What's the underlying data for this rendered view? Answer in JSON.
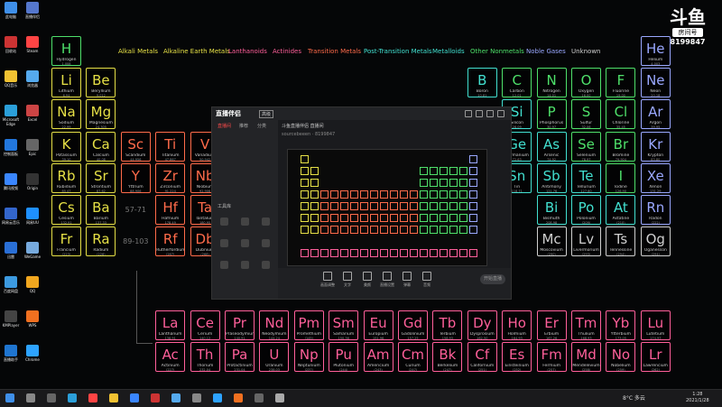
{
  "brand": {
    "logo_mark": "斗鱼",
    "logo_tag": "房间号",
    "room_number": "8199847"
  },
  "legend": [
    {
      "label": "Alkali Metals",
      "color": "#e6e046"
    },
    {
      "label": "Alkaline Earth Metals",
      "color": "#e6e046"
    },
    {
      "label": "Lanthanoids",
      "color": "#ff5f9a"
    },
    {
      "label": "Actinides",
      "color": "#ff5f9a"
    },
    {
      "label": "Transition Metals",
      "color": "#ff6b4a"
    },
    {
      "label": "Post-Transition Metals",
      "color": "#42e0d0"
    },
    {
      "label": "Metalloids",
      "color": "#42e0d0"
    },
    {
      "label": "Other Nonmetals",
      "color": "#4ee06a"
    },
    {
      "label": "Noble Gases",
      "color": "#9aa8ff"
    },
    {
      "label": "Unknown",
      "color": "#cfcfcf"
    }
  ],
  "colors": {
    "alkali": "#e6e046",
    "alkaline": "#e6e046",
    "transition": "#ff6b4a",
    "post": "#42e0d0",
    "metalloid": "#42e0d0",
    "nonmetal": "#4ee06a",
    "noble": "#9aa8ff",
    "lanthanoid": "#ff5f9a",
    "actinide": "#ff5f9a",
    "unknown": "#cfcfcf"
  },
  "elements": [
    {
      "sym": "H",
      "name": "Hydrogen",
      "wt": "1.008",
      "cat": "nonmetal",
      "col": 1,
      "row": 1
    },
    {
      "sym": "He",
      "name": "Helium",
      "wt": "4.003",
      "cat": "noble",
      "col": 18,
      "row": 1
    },
    {
      "sym": "Li",
      "name": "Lithium",
      "wt": "6.94",
      "cat": "alkali",
      "col": 1,
      "row": 2
    },
    {
      "sym": "Be",
      "name": "Beryllium",
      "wt": "9.012",
      "cat": "alkaline",
      "col": 2,
      "row": 2
    },
    {
      "sym": "B",
      "name": "Boron",
      "wt": "10.81",
      "cat": "metalloid",
      "col": 13,
      "row": 2
    },
    {
      "sym": "C",
      "name": "Carbon",
      "wt": "12.01",
      "cat": "nonmetal",
      "col": 14,
      "row": 2
    },
    {
      "sym": "N",
      "name": "Nitrogen",
      "wt": "14.01",
      "cat": "nonmetal",
      "col": 15,
      "row": 2
    },
    {
      "sym": "O",
      "name": "Oxygen",
      "wt": "16.00",
      "cat": "nonmetal",
      "col": 16,
      "row": 2
    },
    {
      "sym": "F",
      "name": "Fluorine",
      "wt": "19.00",
      "cat": "nonmetal",
      "col": 17,
      "row": 2
    },
    {
      "sym": "Ne",
      "name": "Neon",
      "wt": "20.18",
      "cat": "noble",
      "col": 18,
      "row": 2
    },
    {
      "sym": "Na",
      "name": "Sodium",
      "wt": "22.99",
      "cat": "alkali",
      "col": 1,
      "row": 3
    },
    {
      "sym": "Mg",
      "name": "Magnesium",
      "wt": "24.305",
      "cat": "alkaline",
      "col": 2,
      "row": 3
    },
    {
      "sym": "Si",
      "name": "Silicon",
      "wt": "28.09",
      "cat": "metalloid",
      "col": 14,
      "row": 3
    },
    {
      "sym": "P",
      "name": "Phosphorus",
      "wt": "30.97",
      "cat": "nonmetal",
      "col": 15,
      "row": 3
    },
    {
      "sym": "S",
      "name": "Sulfur",
      "wt": "32.06",
      "cat": "nonmetal",
      "col": 16,
      "row": 3
    },
    {
      "sym": "Cl",
      "name": "Chlorine",
      "wt": "35.45",
      "cat": "nonmetal",
      "col": 17,
      "row": 3
    },
    {
      "sym": "Ar",
      "name": "Argon",
      "wt": "39.95",
      "cat": "noble",
      "col": 18,
      "row": 3
    },
    {
      "sym": "K",
      "name": "Potassium",
      "wt": "39.10",
      "cat": "alkali",
      "col": 1,
      "row": 4
    },
    {
      "sym": "Ca",
      "name": "Calcium",
      "wt": "40.08",
      "cat": "alkaline",
      "col": 2,
      "row": 4
    },
    {
      "sym": "Sc",
      "name": "Scandium",
      "wt": "44.956",
      "cat": "transition",
      "col": 3,
      "row": 4
    },
    {
      "sym": "Ti",
      "name": "Titanium",
      "wt": "47.867",
      "cat": "transition",
      "col": 4,
      "row": 4
    },
    {
      "sym": "V",
      "name": "Vanadium",
      "wt": "50.942",
      "cat": "transition",
      "col": 5,
      "row": 4
    },
    {
      "sym": "Ge",
      "name": "Germanium",
      "wt": "72.63",
      "cat": "metalloid",
      "col": 14,
      "row": 4
    },
    {
      "sym": "As",
      "name": "Arsenic",
      "wt": "74.92",
      "cat": "metalloid",
      "col": 15,
      "row": 4
    },
    {
      "sym": "Se",
      "name": "Selenium",
      "wt": "78.97",
      "cat": "nonmetal",
      "col": 16,
      "row": 4
    },
    {
      "sym": "Br",
      "name": "Bromine",
      "wt": "79.904",
      "cat": "nonmetal",
      "col": 17,
      "row": 4
    },
    {
      "sym": "Kr",
      "name": "Krypton",
      "wt": "83.80",
      "cat": "noble",
      "col": 18,
      "row": 4
    },
    {
      "sym": "Rb",
      "name": "Rubidium",
      "wt": "85.47",
      "cat": "alkali",
      "col": 1,
      "row": 5
    },
    {
      "sym": "Sr",
      "name": "Strontium",
      "wt": "87.62",
      "cat": "alkaline",
      "col": 2,
      "row": 5
    },
    {
      "sym": "Y",
      "name": "Yttrium",
      "wt": "88.906",
      "cat": "transition",
      "col": 3,
      "row": 5
    },
    {
      "sym": "Zr",
      "name": "Zirconium",
      "wt": "91.224",
      "cat": "transition",
      "col": 4,
      "row": 5
    },
    {
      "sym": "Nb",
      "name": "Niobium",
      "wt": "92.906",
      "cat": "transition",
      "col": 5,
      "row": 5
    },
    {
      "sym": "Sn",
      "name": "Tin",
      "wt": "118.71",
      "cat": "post",
      "col": 14,
      "row": 5
    },
    {
      "sym": "Sb",
      "name": "Antimony",
      "wt": "121.76",
      "cat": "metalloid",
      "col": 15,
      "row": 5
    },
    {
      "sym": "Te",
      "name": "Tellurium",
      "wt": "127.60",
      "cat": "metalloid",
      "col": 16,
      "row": 5
    },
    {
      "sym": "I",
      "name": "Iodine",
      "wt": "126.90",
      "cat": "nonmetal",
      "col": 17,
      "row": 5
    },
    {
      "sym": "Xe",
      "name": "Xenon",
      "wt": "131.29",
      "cat": "noble",
      "col": 18,
      "row": 5
    },
    {
      "sym": "Cs",
      "name": "Cesium",
      "wt": "132.91",
      "cat": "alkali",
      "col": 1,
      "row": 6
    },
    {
      "sym": "Ba",
      "name": "Barium",
      "wt": "137.33",
      "cat": "alkaline",
      "col": 2,
      "row": 6
    },
    {
      "sym": "Hf",
      "name": "Hafnium",
      "wt": "178.49",
      "cat": "transition",
      "col": 4,
      "row": 6
    },
    {
      "sym": "Ta",
      "name": "Tantalum",
      "wt": "180.95",
      "cat": "transition",
      "col": 5,
      "row": 6
    },
    {
      "sym": "Bi",
      "name": "Bismuth",
      "wt": "208.98",
      "cat": "post",
      "col": 15,
      "row": 6
    },
    {
      "sym": "Po",
      "name": "Polonium",
      "wt": "(209)",
      "cat": "post",
      "col": 16,
      "row": 6
    },
    {
      "sym": "At",
      "name": "Astatine",
      "wt": "(210)",
      "cat": "metalloid",
      "col": 17,
      "row": 6
    },
    {
      "sym": "Rn",
      "name": "Radon",
      "wt": "(222)",
      "cat": "noble",
      "col": 18,
      "row": 6
    },
    {
      "sym": "Fr",
      "name": "Francium",
      "wt": "(223)",
      "cat": "alkali",
      "col": 1,
      "row": 7
    },
    {
      "sym": "Ra",
      "name": "Radium",
      "wt": "(226)",
      "cat": "alkaline",
      "col": 2,
      "row": 7
    },
    {
      "sym": "Rf",
      "name": "Rutherfordium",
      "wt": "(267)",
      "cat": "transition",
      "col": 4,
      "row": 7
    },
    {
      "sym": "Db",
      "name": "Dubnium",
      "wt": "(268)",
      "cat": "transition",
      "col": 5,
      "row": 7
    },
    {
      "sym": "Mc",
      "name": "Moscovium",
      "wt": "(290)",
      "cat": "unknown",
      "col": 15,
      "row": 7
    },
    {
      "sym": "Lv",
      "name": "Livermorium",
      "wt": "(293)",
      "cat": "unknown",
      "col": 16,
      "row": 7
    },
    {
      "sym": "Ts",
      "name": "Tennessine",
      "wt": "(294)",
      "cat": "unknown",
      "col": 17,
      "row": 7
    },
    {
      "sym": "Og",
      "name": "Oganesson",
      "wt": "(294)",
      "cat": "unknown",
      "col": 18,
      "row": 7
    },
    {
      "sym": "La",
      "name": "Lanthanum",
      "wt": "138.91",
      "cat": "lanthanoid",
      "col": 4,
      "row": 9
    },
    {
      "sym": "Ce",
      "name": "Cerium",
      "wt": "140.12",
      "cat": "lanthanoid",
      "col": 5,
      "row": 9
    },
    {
      "sym": "Pr",
      "name": "Praseodymium",
      "wt": "140.91",
      "cat": "lanthanoid",
      "col": 6,
      "row": 9
    },
    {
      "sym": "Nd",
      "name": "Neodymium",
      "wt": "144.24",
      "cat": "lanthanoid",
      "col": 7,
      "row": 9
    },
    {
      "sym": "Pm",
      "name": "Promethium",
      "wt": "(145)",
      "cat": "lanthanoid",
      "col": 8,
      "row": 9
    },
    {
      "sym": "Sm",
      "name": "Samarium",
      "wt": "150.36",
      "cat": "lanthanoid",
      "col": 9,
      "row": 9
    },
    {
      "sym": "Eu",
      "name": "Europium",
      "wt": "151.96",
      "cat": "lanthanoid",
      "col": 10,
      "row": 9
    },
    {
      "sym": "Gd",
      "name": "Gadolinium",
      "wt": "157.25",
      "cat": "lanthanoid",
      "col": 11,
      "row": 9
    },
    {
      "sym": "Tb",
      "name": "Terbium",
      "wt": "158.93",
      "cat": "lanthanoid",
      "col": 12,
      "row": 9
    },
    {
      "sym": "Dy",
      "name": "Dysprosium",
      "wt": "162.50",
      "cat": "lanthanoid",
      "col": 13,
      "row": 9
    },
    {
      "sym": "Ho",
      "name": "Holmium",
      "wt": "164.93",
      "cat": "lanthanoid",
      "col": 14,
      "row": 9
    },
    {
      "sym": "Er",
      "name": "Erbium",
      "wt": "167.26",
      "cat": "lanthanoid",
      "col": 15,
      "row": 9
    },
    {
      "sym": "Tm",
      "name": "Thulium",
      "wt": "168.93",
      "cat": "lanthanoid",
      "col": 16,
      "row": 9
    },
    {
      "sym": "Yb",
      "name": "Ytterbium",
      "wt": "173.05",
      "cat": "lanthanoid",
      "col": 17,
      "row": 9
    },
    {
      "sym": "Lu",
      "name": "Lutetium",
      "wt": "174.97",
      "cat": "lanthanoid",
      "col": 18,
      "row": 9
    },
    {
      "sym": "Ac",
      "name": "Actinium",
      "wt": "(227)",
      "cat": "actinide",
      "col": 4,
      "row": 10
    },
    {
      "sym": "Th",
      "name": "Thorium",
      "wt": "232.04",
      "cat": "actinide",
      "col": 5,
      "row": 10
    },
    {
      "sym": "Pa",
      "name": "Protactinium",
      "wt": "231.04",
      "cat": "actinide",
      "col": 6,
      "row": 10
    },
    {
      "sym": "U",
      "name": "Uranium",
      "wt": "238.03",
      "cat": "actinide",
      "col": 7,
      "row": 10
    },
    {
      "sym": "Np",
      "name": "Neptunium",
      "wt": "(237)",
      "cat": "actinide",
      "col": 8,
      "row": 10
    },
    {
      "sym": "Pu",
      "name": "Plutonium",
      "wt": "(244)",
      "cat": "actinide",
      "col": 9,
      "row": 10
    },
    {
      "sym": "Am",
      "name": "Americium",
      "wt": "(243)",
      "cat": "actinide",
      "col": 10,
      "row": 10
    },
    {
      "sym": "Cm",
      "name": "Curium",
      "wt": "(247)",
      "cat": "actinide",
      "col": 11,
      "row": 10
    },
    {
      "sym": "Bk",
      "name": "Berkelium",
      "wt": "(247)",
      "cat": "actinide",
      "col": 12,
      "row": 10
    },
    {
      "sym": "Cf",
      "name": "Californium",
      "wt": "(251)",
      "cat": "actinide",
      "col": 13,
      "row": 10
    },
    {
      "sym": "Es",
      "name": "Einsteinium",
      "wt": "(252)",
      "cat": "actinide",
      "col": 14,
      "row": 10
    },
    {
      "sym": "Fm",
      "name": "Fermium",
      "wt": "(257)",
      "cat": "actinide",
      "col": 15,
      "row": 10
    },
    {
      "sym": "Md",
      "name": "Mendelevium",
      "wt": "(258)",
      "cat": "actinide",
      "col": 16,
      "row": 10
    },
    {
      "sym": "No",
      "name": "Nobelium",
      "wt": "(259)",
      "cat": "actinide",
      "col": 17,
      "row": 10
    },
    {
      "sym": "Lr",
      "name": "Lawrencium",
      "wt": "(262)",
      "cat": "actinide",
      "col": 18,
      "row": 10
    }
  ],
  "ranges": [
    {
      "label": "57-71",
      "col": 3,
      "row": 6
    },
    {
      "label": "89-103",
      "col": 3,
      "row": 7
    }
  ],
  "desktop_icons": [
    {
      "label": "此电脑",
      "color": "#3f8fe8"
    },
    {
      "label": "直播伴侣",
      "color": "#5577cc"
    },
    {
      "label": "回收站",
      "color": "#c33"
    },
    {
      "label": "Steam",
      "color": "#ff4444"
    },
    {
      "label": "QQ音乐",
      "color": "#f1c232"
    },
    {
      "label": "浏览器",
      "color": "#55aaee"
    },
    {
      "label": "Microsoft Edge",
      "color": "#2b9fd9"
    },
    {
      "label": "Excel",
      "color": "#c44"
    },
    {
      "label": "控制面板",
      "color": "#2277dd"
    },
    {
      "label": "Epic",
      "color": "#666"
    },
    {
      "label": "腾讯视频",
      "color": "#3a86ff"
    },
    {
      "label": "Origin",
      "color": "#333"
    },
    {
      "label": "网易云音乐",
      "color": "#3366cc"
    },
    {
      "label": "网易UU",
      "color": "#1e90ff"
    },
    {
      "label": "迅雷",
      "color": "#2a6fd6"
    },
    {
      "label": "WeGame",
      "color": "#77aadd"
    },
    {
      "label": "百度网盘",
      "color": "#3c9ae0"
    },
    {
      "label": "QQ",
      "color": "#f1a71f"
    },
    {
      "label": "KMPlayer",
      "color": "#444"
    },
    {
      "label": "WPS",
      "color": "#f07020"
    },
    {
      "label": "直播助手",
      "color": "#1f75d0"
    },
    {
      "label": "Chrome",
      "color": "#2da3ff"
    }
  ],
  "obs": {
    "app_name": "直播伴侣",
    "badge": "高级",
    "side_tabs": [
      "直播间",
      "推荐",
      "分类"
    ],
    "scene_label": "工具库",
    "main_title": "斗鱼直播伴侣 直播间",
    "room_line": "sourcebeeen · 8199847",
    "bottom_buttons": [
      "画面调整",
      "文字",
      "美颜",
      "直播设置",
      "弹幕",
      "音频"
    ],
    "live_button": "开始直播"
  },
  "tray": {
    "weather": "8°C 多云",
    "time": "1:28",
    "date": "2021/1/28"
  }
}
